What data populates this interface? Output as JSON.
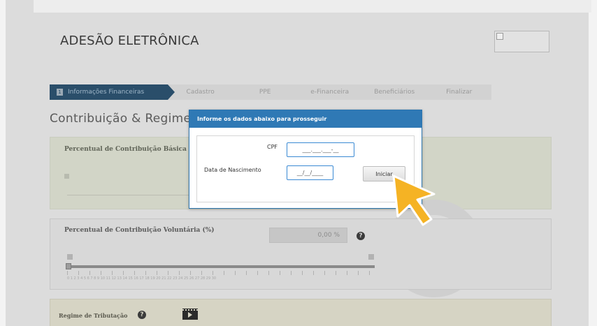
{
  "header": {
    "title": "ADESÃO ELETRÔNICA"
  },
  "steps": [
    {
      "num": "1",
      "label": "Informações Financeiras",
      "active": true
    },
    {
      "label": "Cadastro"
    },
    {
      "label": "PPE"
    },
    {
      "label": "e-Financeira"
    },
    {
      "label": "Beneficiários"
    },
    {
      "label": "Finalizar"
    }
  ],
  "section": {
    "title": "Contribuição & Regime d"
  },
  "basic": {
    "label": "Percentual de Contribuição Básica (%"
  },
  "voluntary": {
    "label": "Percentual de Contribuição Voluntária (%)",
    "value": "0,00 %",
    "help_icon": "question-circle-icon",
    "scale": "0 1 2 3 4 5 6 7 8 9 10 11 12 13 14 15 16 17 18 19 20 21 22 23 24 25 26 27 28 29 30"
  },
  "regime": {
    "label": "Regime de Tributação",
    "help_icon": "question-circle-icon",
    "video_icon": "video-icon"
  },
  "modal": {
    "title": "Informe os dados abaixo para prosseguir",
    "cpf_label": "CPF",
    "cpf_mask": "___.___.___-__",
    "dob_label": "Data de Nascimento",
    "dob_mask": "__/__/____",
    "submit_label": "Iniciar"
  },
  "colors": {
    "modal_header": "#2f79b5",
    "step_active": "#2a4e6a",
    "cursor": "#f5b324"
  }
}
